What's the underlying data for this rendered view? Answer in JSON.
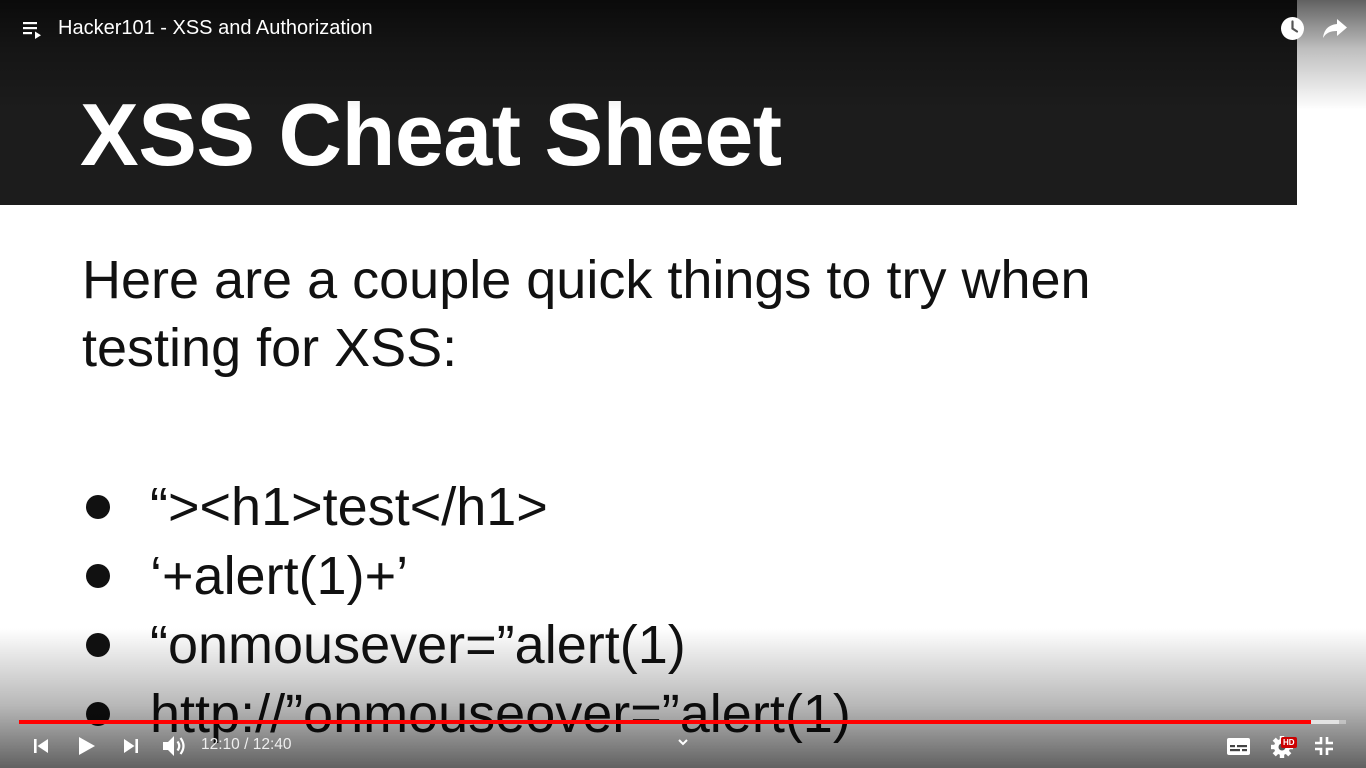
{
  "window": {
    "title": "Hacker101 - XSS and Authorization"
  },
  "slide": {
    "title": "XSS Cheat Sheet",
    "intro": "Here are a couple quick things to try when testing for XSS:",
    "bullets": [
      "“><h1>test</h1>",
      "‘+alert(1)+’",
      "“onmousever=”alert(1)",
      "http://”onmouseover=”alert(1)"
    ]
  },
  "player": {
    "time_current": "12:10",
    "time_separator": " / ",
    "time_total": "12:40",
    "progress_played_fraction": 0.9735,
    "progress_buffered_fraction": 0.995,
    "hd_badge": "HD",
    "colors": {
      "progress": "#ff0000",
      "hd_badge": "#cc0000",
      "slide_header": "#1c1c1c"
    }
  },
  "icons": {
    "playlist": "playlist-icon",
    "watch_later": "clock-icon",
    "share": "share-arrow-icon",
    "previous": "skip-previous-icon",
    "play": "play-icon",
    "next": "skip-next-icon",
    "volume": "volume-icon",
    "more": "chevron-down-icon",
    "subtitles": "subtitles-icon",
    "settings": "gear-icon",
    "fullscreen": "exit-fullscreen-icon"
  }
}
